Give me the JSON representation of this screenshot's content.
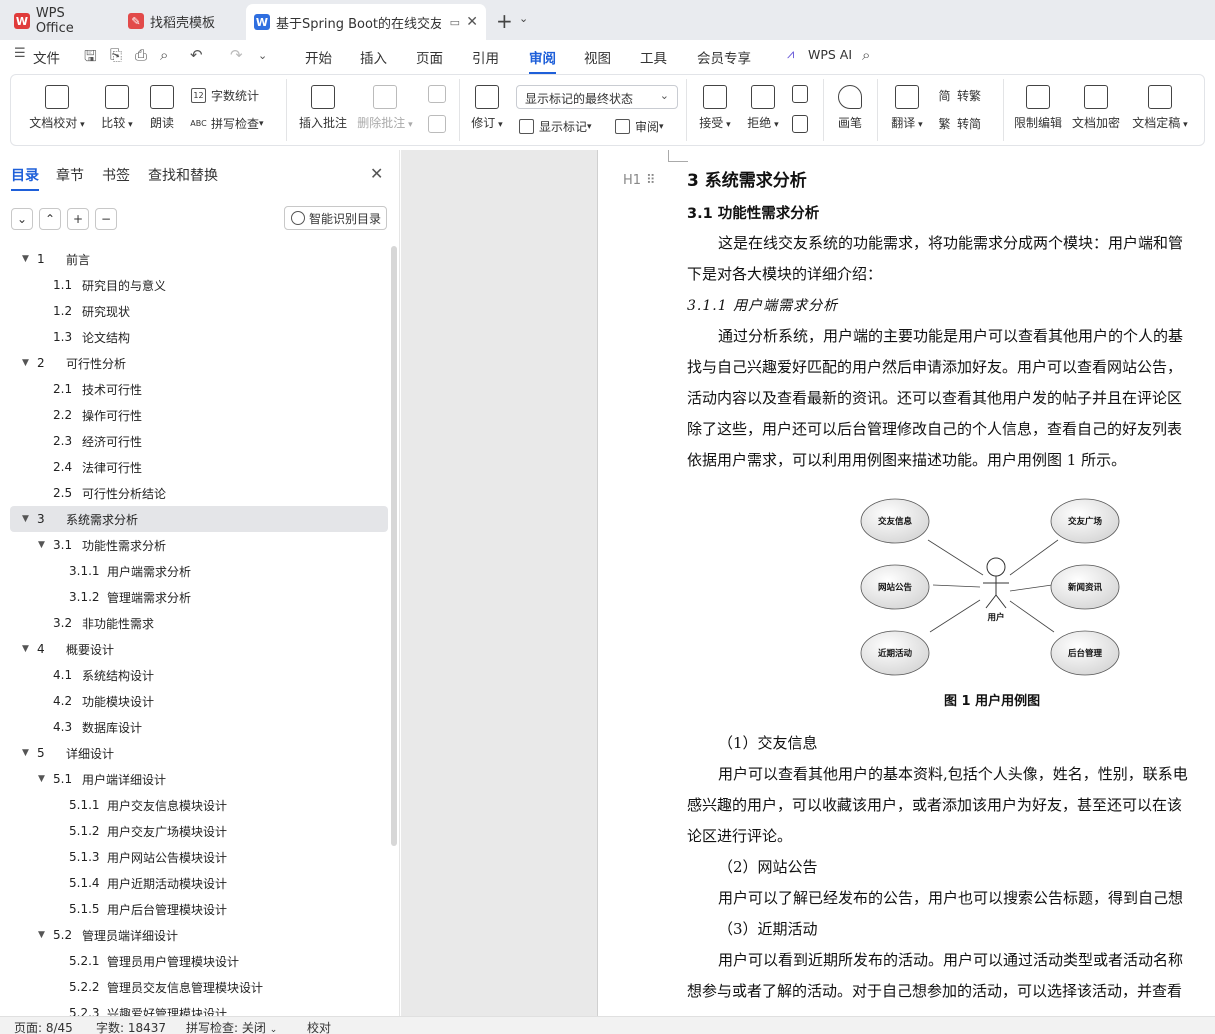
{
  "tabs": [
    {
      "label": "WPS Office",
      "icon": "wps-icon"
    },
    {
      "label": "找稻壳模板",
      "icon": "docer-icon"
    },
    {
      "label": "基于Spring Boot的在线交友系",
      "icon": "word-doc-icon"
    }
  ],
  "menu": {
    "file": "文件",
    "items": [
      "开始",
      "插入",
      "页面",
      "引用",
      "审阅",
      "视图",
      "工具",
      "会员专享"
    ],
    "active": "审阅",
    "ai": "WPS AI"
  },
  "ribbon": {
    "doc_check": "文档校对",
    "compare": "比较",
    "read_aloud": "朗读",
    "word_count": "字数统计",
    "spell_check": "拼写检查",
    "insert_comment": "插入批注",
    "delete_comment": "删除批注",
    "revise": "修订",
    "markup_state": "显示标记的最终状态",
    "show_markup": "显示标记",
    "review": "审阅",
    "accept": "接受",
    "reject": "拒绝",
    "pen": "画笔",
    "translate": "翻译",
    "to_traditional": "转繁",
    "to_simplified": "转简",
    "restrict_edit": "限制编辑",
    "encrypt": "文档加密",
    "finalize": "文档定稿"
  },
  "panel": {
    "tabs": [
      "目录",
      "章节",
      "书签",
      "查找和替换"
    ],
    "active": "目录",
    "smart_toc": "智能识别目录"
  },
  "toc": [
    {
      "num": "1",
      "title": "前言",
      "level": 1
    },
    {
      "num": "1.1",
      "title": "研究目的与意义",
      "level": 2
    },
    {
      "num": "1.2",
      "title": "研究现状",
      "level": 2
    },
    {
      "num": "1.3",
      "title": "论文结构",
      "level": 2
    },
    {
      "num": "2",
      "title": "可行性分析",
      "level": 1
    },
    {
      "num": "2.1",
      "title": "技术可行性",
      "level": 2
    },
    {
      "num": "2.2",
      "title": "操作可行性",
      "level": 2
    },
    {
      "num": "2.3",
      "title": "经济可行性",
      "level": 2
    },
    {
      "num": "2.4",
      "title": "法律可行性",
      "level": 2
    },
    {
      "num": "2.5",
      "title": "可行性分析结论",
      "level": 2
    },
    {
      "num": "3",
      "title": "系统需求分析",
      "level": 1,
      "selected": true
    },
    {
      "num": "3.1",
      "title": "功能性需求分析",
      "level": 2,
      "expandable": true
    },
    {
      "num": "3.1.1",
      "title": "用户端需求分析",
      "level": 3
    },
    {
      "num": "3.1.2",
      "title": "管理端需求分析",
      "level": 3
    },
    {
      "num": "3.2",
      "title": "非功能性需求",
      "level": 2
    },
    {
      "num": "4",
      "title": "概要设计",
      "level": 1
    },
    {
      "num": "4.1",
      "title": "系统结构设计",
      "level": 2
    },
    {
      "num": "4.2",
      "title": "功能模块设计",
      "level": 2
    },
    {
      "num": "4.3",
      "title": "数据库设计",
      "level": 2
    },
    {
      "num": "5",
      "title": "详细设计",
      "level": 1
    },
    {
      "num": "5.1",
      "title": "用户端详细设计",
      "level": 2,
      "expandable": true
    },
    {
      "num": "5.1.1",
      "title": "用户交友信息模块设计",
      "level": 3
    },
    {
      "num": "5.1.2",
      "title": "用户交友广场模块设计",
      "level": 3
    },
    {
      "num": "5.1.3",
      "title": "用户网站公告模块设计",
      "level": 3
    },
    {
      "num": "5.1.4",
      "title": "用户近期活动模块设计",
      "level": 3
    },
    {
      "num": "5.1.5",
      "title": "用户后台管理模块设计",
      "level": 3
    },
    {
      "num": "5.2",
      "title": "管理员端详细设计",
      "level": 2,
      "expandable": true
    },
    {
      "num": "5.2.1",
      "title": "管理员用户管理模块设计",
      "level": 3
    },
    {
      "num": "5.2.2",
      "title": "管理员交友信息管理模块设计",
      "level": 3
    },
    {
      "num": "5.2.3",
      "title": "兴趣爱好管理模块设计",
      "level": 3
    }
  ],
  "doc": {
    "h1_marker": "H1",
    "h1": "3    系统需求分析",
    "h2": "3.1    功能性需求分析",
    "p1a": "这是在线交友系统的功能需求，将功能需求分成两个模块：用户端和管",
    "p1b": "下是对各大模块的详细介绍：",
    "h3": "3.1.1    用户端需求分析",
    "p2a": "通过分析系统，用户端的主要功能是用户可以查看其他用户的个人的基",
    "p2b": "找与自己兴趣爱好匹配的用户然后申请添加好友。用户可以查看网站公告，",
    "p2c": "活动内容以及查看最新的资讯。还可以查看其他用户发的帖子并且在评论区",
    "p2d": "除了这些，用户还可以后台管理修改自己的个人信息，查看自己的好友列表",
    "p2e": "依据用户需求，可以利用用例图来描述功能。用户用例图 1 所示。",
    "diagram": {
      "actor": "用户",
      "cases": [
        "交友信息",
        "交友广场",
        "网站公告",
        "新闻资讯",
        "近期活动",
        "后台管理"
      ]
    },
    "fig_caption": "图 1 用户用例图",
    "s1": "（1）交友信息",
    "p3a": "用户可以查看其他用户的基本资料,包括个人头像，姓名，性别，联系电",
    "p3b": "感兴趣的用户，可以收藏该用户，或者添加该用户为好友，甚至还可以在该",
    "p3c": "论区进行评论。",
    "s2": "（2）网站公告",
    "p4a": "用户可以了解已经发布的公告，用户也可以搜索公告标题，得到自己想",
    "s3": "（3）近期活动",
    "p5a": "用户可以看到近期所发布的活动。用户可以通过活动类型或者活动名称",
    "p5b": "想参与或者了解的活动。对于自己想参加的活动，可以选择该活动，并查看"
  },
  "status": {
    "page": "页面: 8/45",
    "words": "字数: 18437",
    "spell": "拼写检查: 关闭",
    "proof": "校对"
  }
}
